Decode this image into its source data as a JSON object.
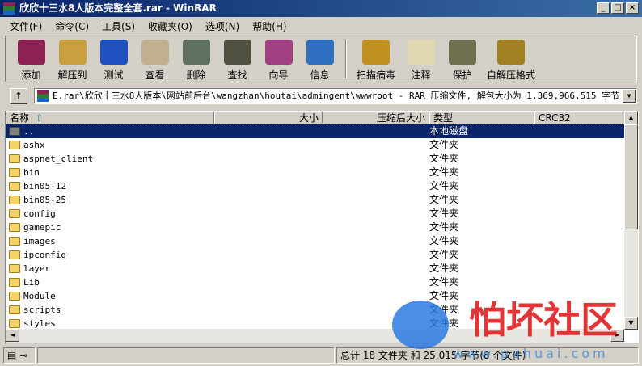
{
  "window": {
    "title": "欣欣十三水8人版本完整全套.rar - WinRAR",
    "min": "_",
    "max": "□",
    "close": "×"
  },
  "menu": [
    "文件(F)",
    "命令(C)",
    "工具(S)",
    "收藏夹(O)",
    "选项(N)",
    "帮助(H)"
  ],
  "toolbar": [
    {
      "label": "添加",
      "icon": "add-icon",
      "color": "#8b2252"
    },
    {
      "label": "解压到",
      "icon": "extract-icon",
      "color": "#c8a040"
    },
    {
      "label": "测试",
      "icon": "test-icon",
      "color": "#2050c0"
    },
    {
      "label": "查看",
      "icon": "view-icon",
      "color": "#c0b090"
    },
    {
      "label": "删除",
      "icon": "delete-icon",
      "color": "#607060"
    },
    {
      "label": "查找",
      "icon": "find-icon",
      "color": "#505040"
    },
    {
      "label": "向导",
      "icon": "wizard-icon",
      "color": "#a04080"
    },
    {
      "label": "信息",
      "icon": "info-icon",
      "color": "#3070c0"
    },
    {
      "label": "扫描病毒",
      "icon": "virus-scan-icon",
      "color": "#c09020"
    },
    {
      "label": "注释",
      "icon": "comment-icon",
      "color": "#e0d8b0"
    },
    {
      "label": "保护",
      "icon": "protect-icon",
      "color": "#707050"
    },
    {
      "label": "自解压格式",
      "icon": "sfx-icon",
      "color": "#a08020"
    }
  ],
  "address": {
    "path": "E.rar\\欣欣十三水8人版本\\网站前后台\\wangzhan\\houtai\\admingent\\wwwroot - RAR 压缩文件, 解包大小为 1,369,966,515 字节"
  },
  "columns": [
    "名称",
    "大小",
    "压缩后大小",
    "类型",
    "CRC32"
  ],
  "sort_indicator": "⇧",
  "rows": [
    {
      "name": "..",
      "type": "本地磁盘"
    },
    {
      "name": "ashx",
      "type": "文件夹"
    },
    {
      "name": "aspnet_client",
      "type": "文件夹"
    },
    {
      "name": "bin",
      "type": "文件夹"
    },
    {
      "name": "bin05-12",
      "type": "文件夹"
    },
    {
      "name": "bin05-25",
      "type": "文件夹"
    },
    {
      "name": "config",
      "type": "文件夹"
    },
    {
      "name": "gamepic",
      "type": "文件夹"
    },
    {
      "name": "images",
      "type": "文件夹"
    },
    {
      "name": "ipconfig",
      "type": "文件夹"
    },
    {
      "name": "layer",
      "type": "文件夹"
    },
    {
      "name": "Lib",
      "type": "文件夹"
    },
    {
      "name": "Module",
      "type": "文件夹"
    },
    {
      "name": "scripts",
      "type": "文件夹"
    },
    {
      "name": "styles",
      "type": "文件夹"
    }
  ],
  "status": {
    "summary": "总计 18 文件夹 和 25,015 字节(8 个文件)"
  },
  "watermark": {
    "text": "怕坏社区",
    "url": "www.pahuai.com"
  }
}
